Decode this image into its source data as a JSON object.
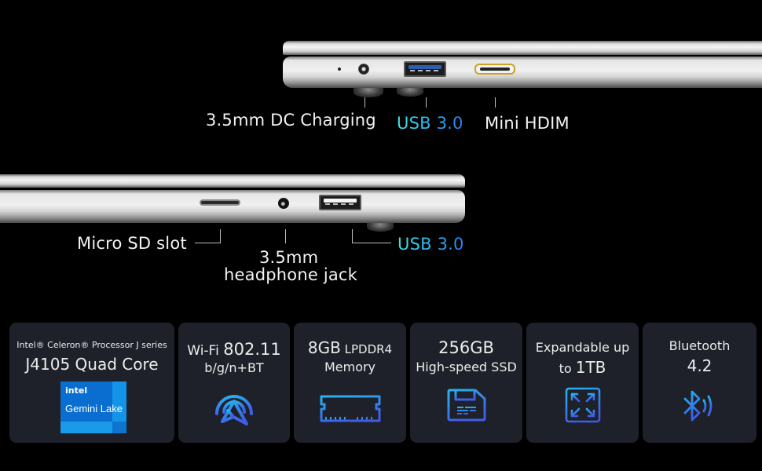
{
  "laptop_top": {
    "ports": [
      "status-led",
      "dc-charging-port",
      "usb-3.0-port",
      "mini-hdmi-port"
    ],
    "labels": {
      "dc_charging": "3.5mm DC Charging",
      "usb": "USB 3.0",
      "hdmi": "Mini HDIM"
    }
  },
  "laptop_bottom": {
    "ports": [
      "micro-sd-slot",
      "headphone-jack",
      "usb-3.0-port"
    ],
    "labels": {
      "micro_sd": "Micro SD slot",
      "headphone_line1": "3.5mm",
      "headphone_line2": "headphone jack",
      "usb": "USB 3.0"
    }
  },
  "colors": {
    "background": "#000000",
    "card_background": "#1e2129",
    "usb_label_gradient_start": "#3ee6e0",
    "usb_label_gradient_end": "#2a7ef5",
    "icon_gradient_start": "#25b6f2",
    "icon_gradient_end": "#3f5ee8",
    "usb_tongue": "#2d5fb0",
    "hdmi_border": "#c9a227",
    "intel_blue": "#0a6ed1"
  },
  "specs": [
    {
      "id": "processor",
      "line1": "Intel® Celeron® Processor J series",
      "line2": "J4105 Quad Core",
      "badge": {
        "brand": "intel",
        "name": "Gemini Lake"
      },
      "icon": "intel-gemini-lake-badge"
    },
    {
      "id": "wifi",
      "line1_prefix": "Wi-Fi ",
      "line1_value": "802.11",
      "line2": "b/g/n+BT",
      "icon": "wifi-antenna-icon"
    },
    {
      "id": "memory",
      "line1_value": "8GB",
      "line1_suffix": " LPDDR4",
      "line2": "Memory",
      "icon": "ram-module-icon"
    },
    {
      "id": "storage",
      "line1": "256GB",
      "line2": "High-speed SSD",
      "icon": "floppy-disk-icon"
    },
    {
      "id": "expandable",
      "line1": "Expandable up",
      "line2_prefix": "to ",
      "line2_value": "1TB",
      "icon": "expand-arrows-icon"
    },
    {
      "id": "bluetooth",
      "line1": "Bluetooth",
      "line2": "4.2",
      "icon": "bluetooth-icon"
    }
  ]
}
